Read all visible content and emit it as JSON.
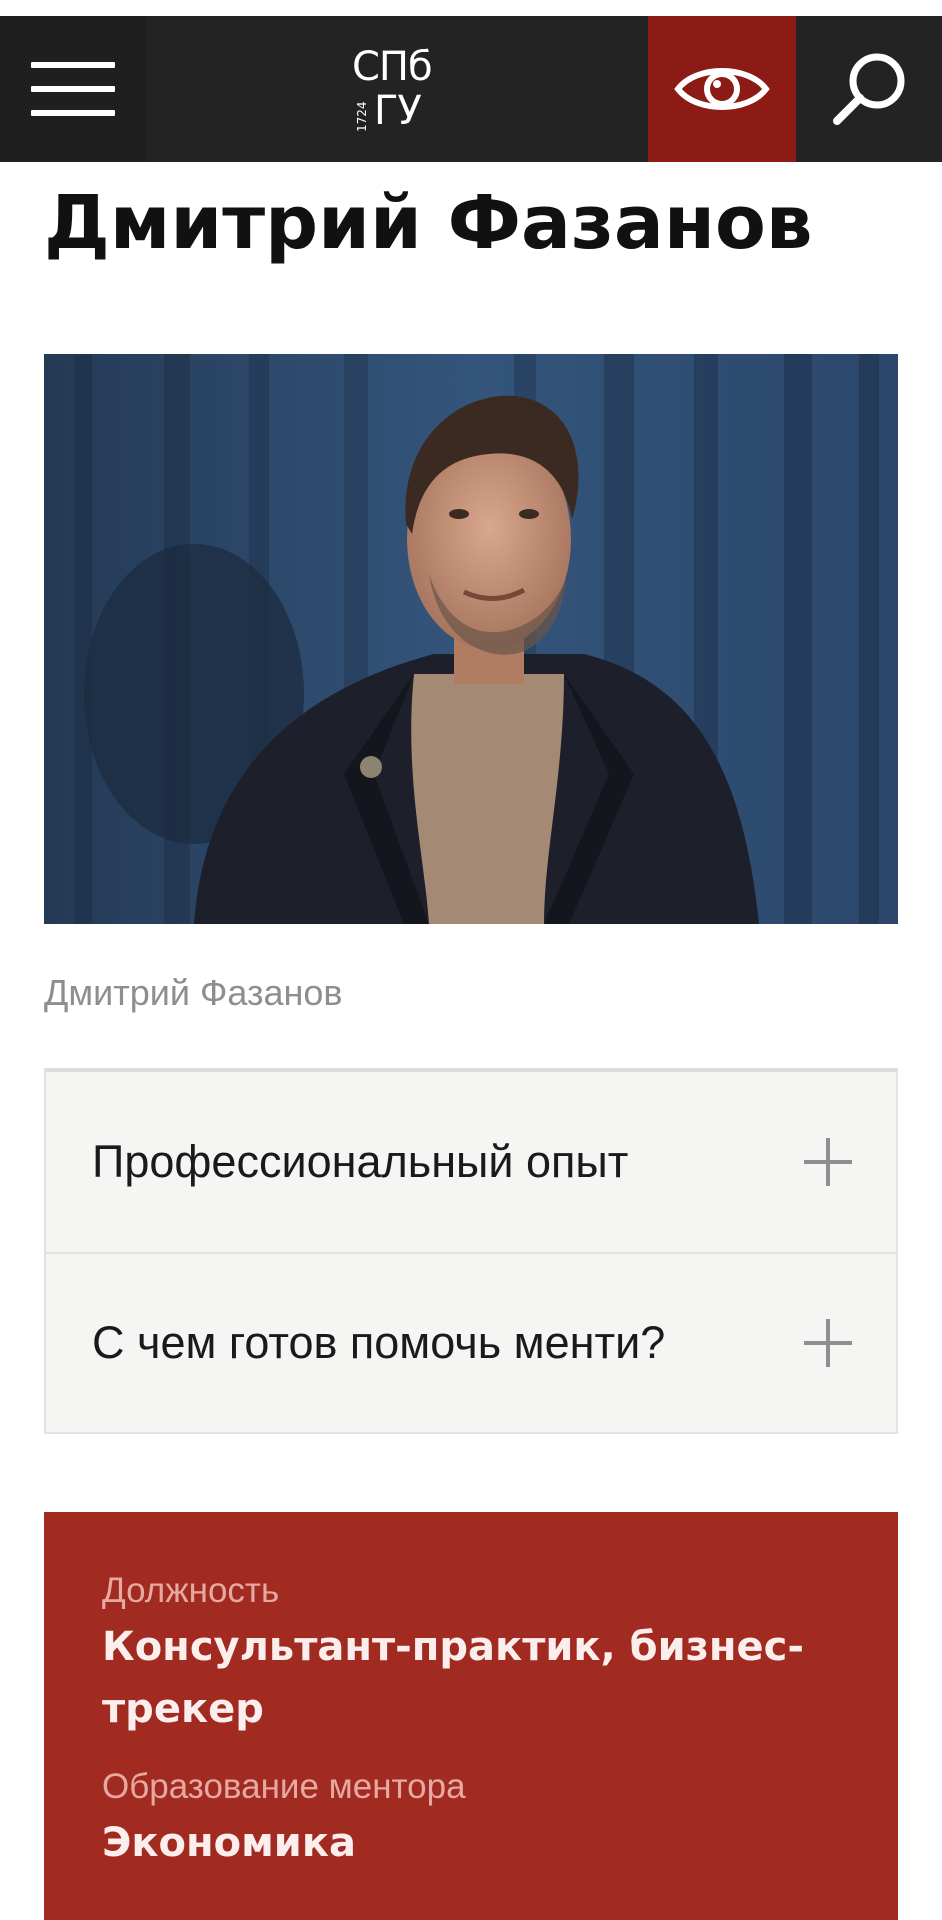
{
  "header": {
    "logo_top": "СПб",
    "logo_bottom": "ГУ",
    "logo_year": "1724",
    "icons": [
      "menu-icon",
      "eye-icon",
      "search-icon"
    ]
  },
  "page": {
    "title": "Дмитрий Фазанов",
    "photo_caption": "Дмитрий Фазанов"
  },
  "accordion": {
    "items": [
      {
        "label": "Профессиональный опыт"
      },
      {
        "label": "С чем готов помочь менти?"
      }
    ]
  },
  "info": {
    "position_label": "Должность",
    "position_value": "Консультант-практик, бизнес-трекер",
    "education_label": "Образование ментора",
    "education_value": "Экономика"
  },
  "colors": {
    "header_bg": "#232323",
    "accent_red": "#8c1b15",
    "card_red": "#a12a21"
  }
}
